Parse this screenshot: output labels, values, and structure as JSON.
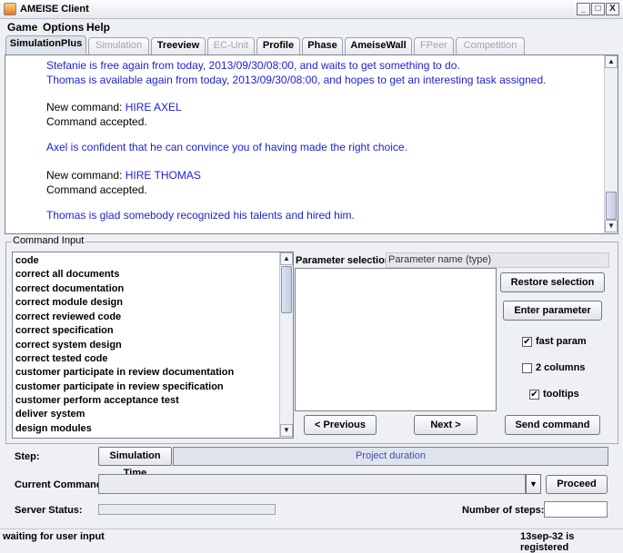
{
  "window": {
    "title": "AMEISE Client",
    "minimize": "_",
    "maximize": "□",
    "close": "X"
  },
  "menu": [
    "Game",
    "Options",
    "Help"
  ],
  "tabs": [
    {
      "label": "SimulationPlus",
      "state": "active"
    },
    {
      "label": "Simulation",
      "state": "disabled"
    },
    {
      "label": "Treeview",
      "state": "normal"
    },
    {
      "label": "EC-Unit",
      "state": "disabled"
    },
    {
      "label": "Profile",
      "state": "normal"
    },
    {
      "label": "Phase",
      "state": "normal"
    },
    {
      "label": "AmeiseWall",
      "state": "normal"
    },
    {
      "label": "FPeer",
      "state": "disabled"
    },
    {
      "label": "Competition",
      "state": "disabled"
    }
  ],
  "log": {
    "lines": [
      {
        "text": "Stefanie is free again from today, 2013/09/30/08:00, and waits to get something to do.",
        "color": "blue"
      },
      {
        "text": "Thomas is available again from today, 2013/09/30/08:00, and hopes to get an interesting task assigned.",
        "color": "blue"
      },
      {
        "prefix": "New command: ",
        "text": "HIRE AXEL",
        "color": "mixed"
      },
      {
        "text": "Command accepted.",
        "color": "black"
      },
      {
        "text": "Axel is confident that he can convince you of having made the right choice.",
        "color": "blue"
      },
      {
        "prefix": "New command: ",
        "text": "HIRE THOMAS",
        "color": "mixed"
      },
      {
        "text": "Command accepted.",
        "color": "black"
      },
      {
        "text": "Thomas is glad somebody recognized his talents and hired him.",
        "color": "blue"
      }
    ]
  },
  "command_input": {
    "title": "Command Input",
    "commands": [
      "code",
      "correct all documents",
      "correct documentation",
      "correct module design",
      "correct reviewed code",
      "correct specification",
      "correct system design",
      "correct tested code",
      "customer participate in review documentation",
      "customer participate in review specification",
      "customer perform acceptance test",
      "deliver system",
      "design modules"
    ],
    "parameter_selection_label": "Parameter selection",
    "parameter_header": "Parameter name (type)",
    "restore_button": "Restore selection",
    "enter_parameter_button": "Enter parameter",
    "checkboxes": [
      {
        "label": "fast param",
        "checked": true
      },
      {
        "label": "2 columns",
        "checked": false
      },
      {
        "label": "tooltips",
        "checked": true
      }
    ],
    "previous_button": "< Previous",
    "next_button": "Next >",
    "send_button": "Send command"
  },
  "step": {
    "label": "Step:",
    "sim_time_button": "Simulation Time",
    "project_duration": "Project duration"
  },
  "current_command": {
    "label": "Current Command",
    "value": "",
    "proceed_button": "Proceed"
  },
  "server_status": {
    "label": "Server Status:",
    "number_of_steps_label": "Number of steps:",
    "number_of_steps_value": ""
  },
  "status_bar": {
    "left": "waiting for user input",
    "right": "13sep-32 is registered"
  }
}
